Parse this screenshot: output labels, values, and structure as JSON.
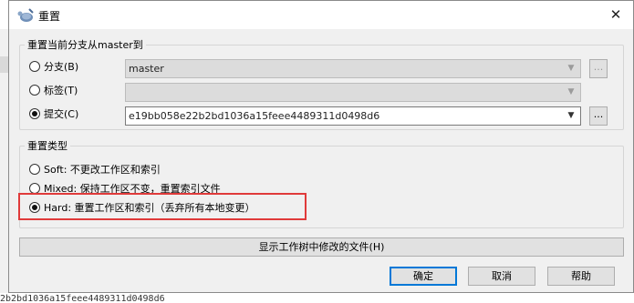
{
  "window": {
    "title": "重置",
    "close_glyph": "✕"
  },
  "branch_group": {
    "legend": "重置当前分支从master到",
    "options": [
      {
        "label": "分支(B)",
        "checked": false,
        "combo_value": "master",
        "combo_enabled": false,
        "browse": "...",
        "browse_enabled": false
      },
      {
        "label": "标签(T)",
        "checked": false,
        "combo_value": "",
        "combo_enabled": false,
        "browse": "",
        "browse_enabled": false
      },
      {
        "label": "提交(C)",
        "checked": true,
        "combo_value": "e19bb058e22b2bd1036a15feee4489311d0498d6",
        "combo_enabled": true,
        "browse": "...",
        "browse_enabled": true
      }
    ]
  },
  "reset_type": {
    "legend": "重置类型",
    "options": [
      {
        "label": "Soft: 不更改工作区和索引",
        "checked": false
      },
      {
        "label": "Mixed: 保持工作区不变，重置索引文件",
        "checked": false
      },
      {
        "label": "Hard: 重置工作区和索引（丢弃所有本地变更）",
        "checked": true
      }
    ]
  },
  "show_changes_button": "显示工作树中修改的文件(H)",
  "buttons": {
    "ok": "确定",
    "cancel": "取消",
    "help": "帮助"
  },
  "background_hash": "2b2bd1036a15feee4489311d0498d6",
  "colors": {
    "highlight": "#e03a3a",
    "default_button_border": "#0078d7",
    "dialog_bg": "#f0f0f0"
  },
  "icons": {
    "app": "tortoise-git-icon",
    "radio_checked": "radio-dot",
    "dropdown": "chevron-down-icon"
  }
}
